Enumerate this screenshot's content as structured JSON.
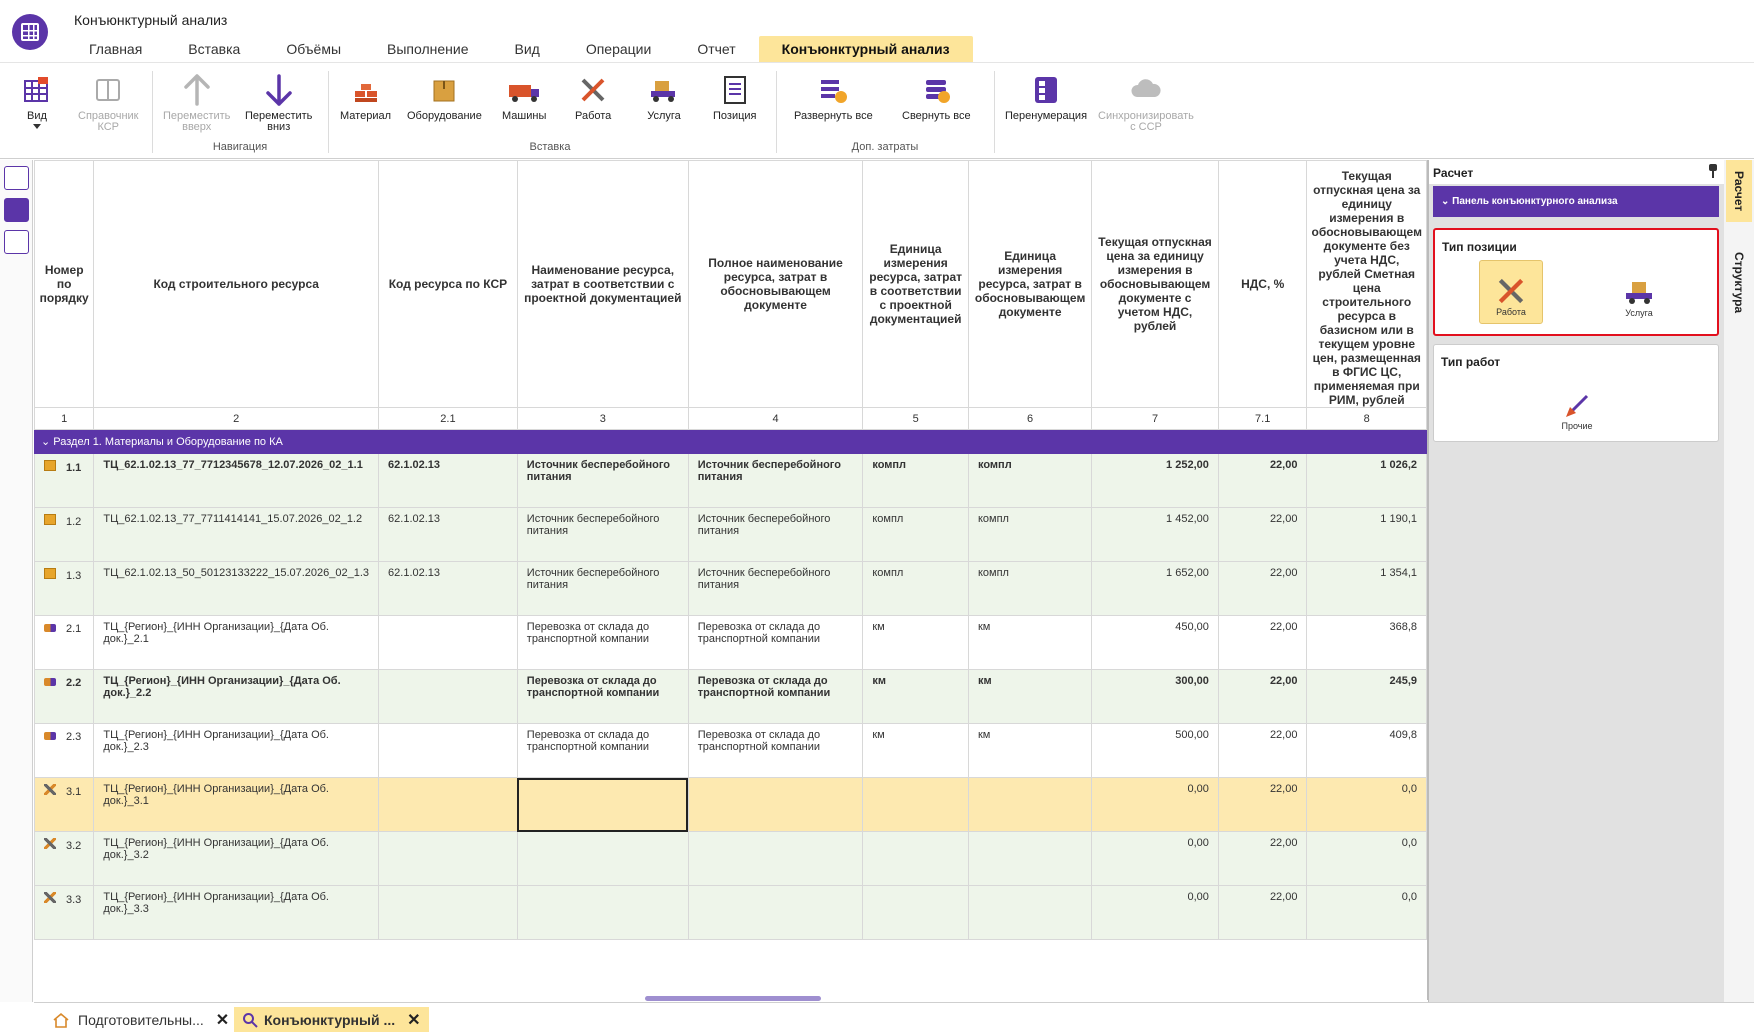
{
  "window": {
    "title": "Конъюнктурный анализ"
  },
  "menu": [
    "Главная",
    "Вставка",
    "Объёмы",
    "Выполнение",
    "Вид",
    "Операции",
    "Отчет",
    "Конъюнктурный анализ"
  ],
  "ribbon": {
    "view": "Вид",
    "ksr": [
      "Справочник",
      "КСР"
    ],
    "move_up": [
      "Переместить",
      "вверх"
    ],
    "move_down": [
      "Переместить",
      "вниз"
    ],
    "nav_group": "Навигация",
    "material": "Материал",
    "equipment": "Оборудование",
    "machines": "Машины",
    "work": "Работа",
    "service": "Услуга",
    "position": "Позиция",
    "insert_group": "Вставка",
    "expand_all": "Развернуть все",
    "collapse_all": "Свернуть все",
    "extra_group": "Доп. затраты",
    "renumber": "Перенумерация",
    "sync": [
      "Синхронизировать",
      "с ССР"
    ]
  },
  "table": {
    "headers": [
      "Номер по порядку",
      "Код строительного ресурса",
      "Код ресурса по КСР",
      "Наименование ресурса, затрат в соответствии с проектной документацией",
      "Полное наименование ресурса, затрат в обосновывающем документе",
      "Единица измерения ресурса, затрат в соответствии с проектной документацией",
      "Единица измерения ресурса, затрат в обосновывающем документе",
      "Текущая отпускная цена за единицу измерения в обосновывающем документе с учетом НДС, рублей",
      "НДС, %",
      "Текущая отпускная цена за единицу измерения в обосновывающем документе без учета НДС, рублей Сметная цена строительного ресурса в базисном или в текущем уровне цен, размещенная в ФГИС ЦС, применяемая при РИМ, рублей"
    ],
    "col_numbers": [
      "1",
      "2",
      "2.1",
      "3",
      "4",
      "5",
      "6",
      "7",
      "7.1",
      "8"
    ],
    "section": "Раздел 1. Материалы и Оборудование по КА",
    "rows": [
      {
        "icon": "material-icon",
        "num": "1.1",
        "code": "ТЦ_62.1.02.13_77_7712345678_12.07.2026_02_1.1",
        "ksr": "62.1.02.13",
        "name": "Источник бесперебойного питания",
        "full_name": "Источник бесперебойного питания",
        "unit": "компл",
        "unit_doc": "компл",
        "price": "1 252,00",
        "vat": "22,00",
        "base": "1 026,2"
      },
      {
        "icon": "material-icon",
        "num": "1.2",
        "code": "ТЦ_62.1.02.13_77_7711414141_15.07.2026_02_1.2",
        "ksr": "62.1.02.13",
        "name": "Источник бесперебойного питания",
        "full_name": "Источник бесперебойного питания",
        "unit": "компл",
        "unit_doc": "компл",
        "price": "1 452,00",
        "vat": "22,00",
        "base": "1 190,1"
      },
      {
        "icon": "material-icon",
        "num": "1.3",
        "code": "ТЦ_62.1.02.13_50_50123133222_15.07.2026_02_1.3",
        "ksr": "62.1.02.13",
        "name": "Источник бесперебойного питания",
        "full_name": "Источник бесперебойного питания",
        "unit": "компл",
        "unit_doc": "компл",
        "price": "1 652,00",
        "vat": "22,00",
        "base": "1 354,1"
      },
      {
        "icon": "truck-icon",
        "num": "2.1",
        "code": "ТЦ_{Регион}_{ИНН Организации}_{Дата Об. док.}_2.1",
        "ksr": "",
        "name": "Перевозка от склада до транспортной компании",
        "full_name": "Перевозка от склада до транспортной компании",
        "unit": "км",
        "unit_doc": "км",
        "price": "450,00",
        "vat": "22,00",
        "base": "368,8"
      },
      {
        "icon": "truck-icon",
        "num": "2.2",
        "code": "ТЦ_{Регион}_{ИНН Организации}_{Дата Об. док.}_2.2",
        "ksr": "",
        "name": "Перевозка от склада до транспортной компании",
        "full_name": "Перевозка от склада до транспортной компании",
        "unit": "км",
        "unit_doc": "км",
        "price": "300,00",
        "vat": "22,00",
        "base": "245,9"
      },
      {
        "icon": "truck-icon",
        "num": "2.3",
        "code": "ТЦ_{Регион}_{ИНН Организации}_{Дата Об. док.}_2.3",
        "ksr": "",
        "name": "Перевозка от склада до транспортной компании",
        "full_name": "Перевозка от склада до транспортной компании",
        "unit": "км",
        "unit_doc": "км",
        "price": "500,00",
        "vat": "22,00",
        "base": "409,8"
      },
      {
        "icon": "tools-icon",
        "num": "3.1",
        "code": "ТЦ_{Регион}_{ИНН Организации}_{Дата Об. док.}_3.1",
        "ksr": "",
        "name": "",
        "full_name": "",
        "unit": "",
        "unit_doc": "",
        "price": "0,00",
        "vat": "22,00",
        "base": "0,0"
      },
      {
        "icon": "tools-icon",
        "num": "3.2",
        "code": "ТЦ_{Регион}_{ИНН Организации}_{Дата Об. док.}_3.2",
        "ksr": "",
        "name": "",
        "full_name": "",
        "unit": "",
        "unit_doc": "",
        "price": "0,00",
        "vat": "22,00",
        "base": "0,0"
      },
      {
        "icon": "tools-icon",
        "num": "3.3",
        "code": "ТЦ_{Регион}_{ИНН Организации}_{Дата Об. док.}_3.3",
        "ksr": "",
        "name": "",
        "full_name": "",
        "unit": "",
        "unit_doc": "",
        "price": "0,00",
        "vat": "22,00",
        "base": "0,0"
      }
    ]
  },
  "panel": {
    "title": "Расчет",
    "bar": "Панель конъюнктурного анализа",
    "type_position": "Тип позиции",
    "opt_work": "Работа",
    "opt_service": "Услуга",
    "type_works": "Тип работ",
    "opt_other": "Прочие"
  },
  "side_tabs": [
    "Расчет",
    "Структура"
  ],
  "doc_tabs": [
    "Подготовительны...",
    "Конъюнктурный ..."
  ]
}
